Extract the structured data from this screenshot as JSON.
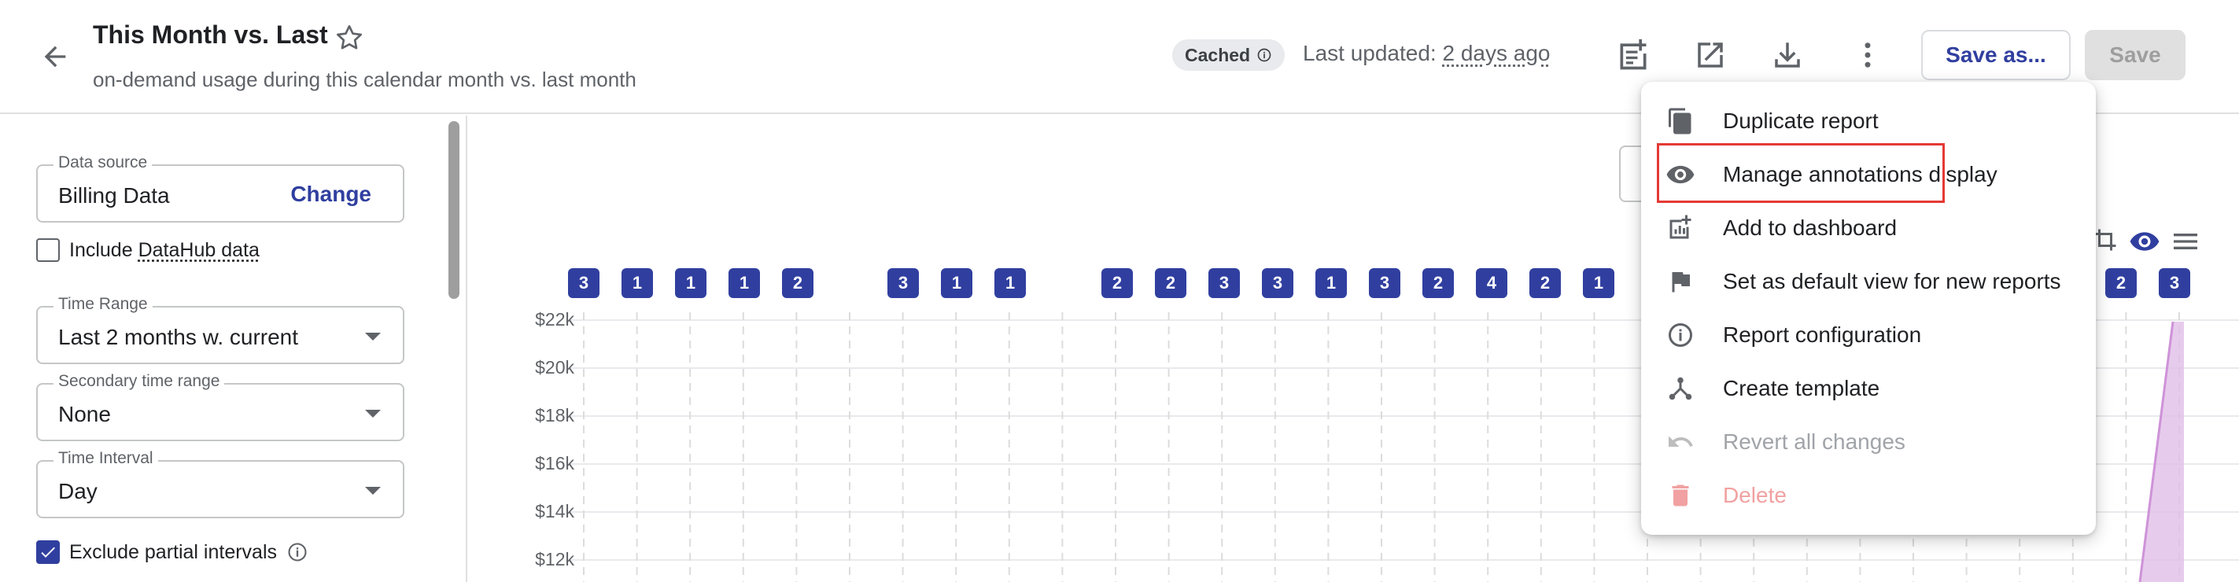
{
  "header": {
    "title": "This Month vs. Last",
    "subtitle": "on-demand usage during this calendar month vs. last month",
    "cached_label": "Cached",
    "last_updated_label": "Last updated:",
    "last_updated_value": "2 days ago",
    "save_as_label": "Save as...",
    "save_label": "Save"
  },
  "filters": {
    "data_source": {
      "label": "Data source",
      "value": "Billing Data",
      "action": "Change"
    },
    "include_datahub": {
      "label_prefix": "Include",
      "label_link": "DataHub data",
      "checked": false
    },
    "time_range": {
      "label": "Time Range",
      "value": "Last 2 months w. current"
    },
    "secondary_time_range": {
      "label": "Secondary time range",
      "value": "None"
    },
    "time_interval": {
      "label": "Time Interval",
      "value": "Day"
    },
    "exclude_partial": {
      "label": "Exclude partial intervals",
      "checked": true
    }
  },
  "chart": {
    "annotation_badges": [
      "3",
      "1",
      "1",
      "1",
      "2",
      "3",
      "1",
      "1",
      "2",
      "2",
      "3",
      "3",
      "1",
      "3",
      "2",
      "4",
      "2",
      "1",
      "2",
      "3"
    ],
    "y_ticks": [
      "$22k",
      "$20k",
      "$18k",
      "$16k",
      "$14k",
      "$12k"
    ]
  },
  "menu": {
    "items": [
      {
        "label": "Duplicate report",
        "icon": "copy-icon",
        "state": "normal"
      },
      {
        "label": "Manage annotations display",
        "icon": "eye-icon",
        "state": "normal"
      },
      {
        "label": "Add to dashboard",
        "icon": "dashboard-add-icon",
        "state": "normal"
      },
      {
        "label": "Set as default view for new reports",
        "icon": "flag-icon",
        "state": "normal"
      },
      {
        "label": "Report configuration",
        "icon": "info-icon",
        "state": "normal"
      },
      {
        "label": "Create template",
        "icon": "template-icon",
        "state": "normal"
      },
      {
        "label": "Revert all changes",
        "icon": "undo-icon",
        "state": "disabled"
      },
      {
        "label": "Delete",
        "icon": "trash-icon",
        "state": "danger"
      }
    ]
  },
  "colors": {
    "primary": "#303f9f",
    "highlight_border": "#e53935",
    "series_fill": "#e1bee7",
    "series_stroke": "#ce93d8"
  }
}
